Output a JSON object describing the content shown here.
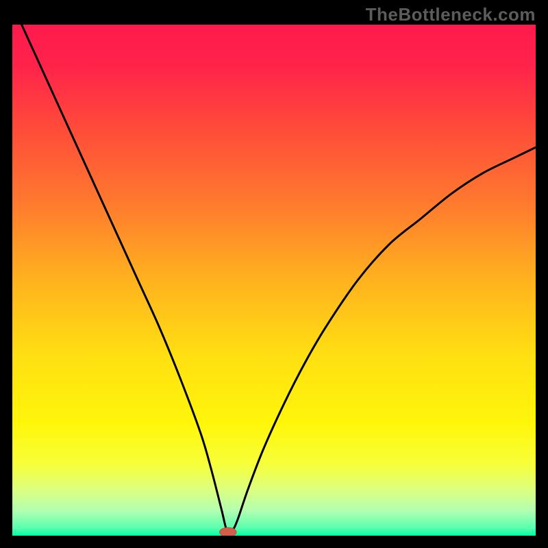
{
  "watermark": "TheBottleneck.com",
  "colors": {
    "frame": "#000000",
    "watermark": "#5c5c5c",
    "gradient_stops": [
      {
        "offset": 0.0,
        "color": "#ff1a4d"
      },
      {
        "offset": 0.08,
        "color": "#ff234a"
      },
      {
        "offset": 0.2,
        "color": "#ff4a3a"
      },
      {
        "offset": 0.35,
        "color": "#ff7a2e"
      },
      {
        "offset": 0.5,
        "color": "#ffb21e"
      },
      {
        "offset": 0.65,
        "color": "#ffe012"
      },
      {
        "offset": 0.78,
        "color": "#fff60a"
      },
      {
        "offset": 0.86,
        "color": "#f7ff3a"
      },
      {
        "offset": 0.91,
        "color": "#dcff80"
      },
      {
        "offset": 0.95,
        "color": "#b4ffb0"
      },
      {
        "offset": 0.985,
        "color": "#5affb0"
      },
      {
        "offset": 1.0,
        "color": "#00ffa0"
      }
    ],
    "curve": "#000000",
    "marker_fill": "#d0604c",
    "marker_stroke": "#c24f3b"
  },
  "chart_data": {
    "type": "line",
    "title": "",
    "xlabel": "",
    "ylabel": "",
    "xlim": [
      0,
      100
    ],
    "ylim": [
      0,
      100
    ],
    "grid": false,
    "notes": "V-shaped bottleneck curve over a red-to-green vertical gradient; minimum (zero bottleneck) near x≈41. No axis tick labels are visible.",
    "series": [
      {
        "name": "bottleneck-curve",
        "x": [
          0,
          4,
          8,
          12,
          16,
          20,
          24,
          28,
          32,
          36,
          38,
          40,
          41,
          42,
          43,
          45,
          48,
          52,
          56,
          60,
          66,
          72,
          78,
          84,
          90,
          96,
          100
        ],
        "values": [
          104,
          95,
          86,
          77,
          68,
          59,
          50,
          41,
          31,
          20,
          13,
          5,
          1,
          1,
          3,
          9,
          17,
          26,
          34,
          41,
          50,
          57,
          62,
          67,
          71,
          74,
          76
        ]
      }
    ],
    "marker": {
      "x": 41.2,
      "y": 0.7,
      "rx": 1.6,
      "ry": 0.9
    }
  }
}
